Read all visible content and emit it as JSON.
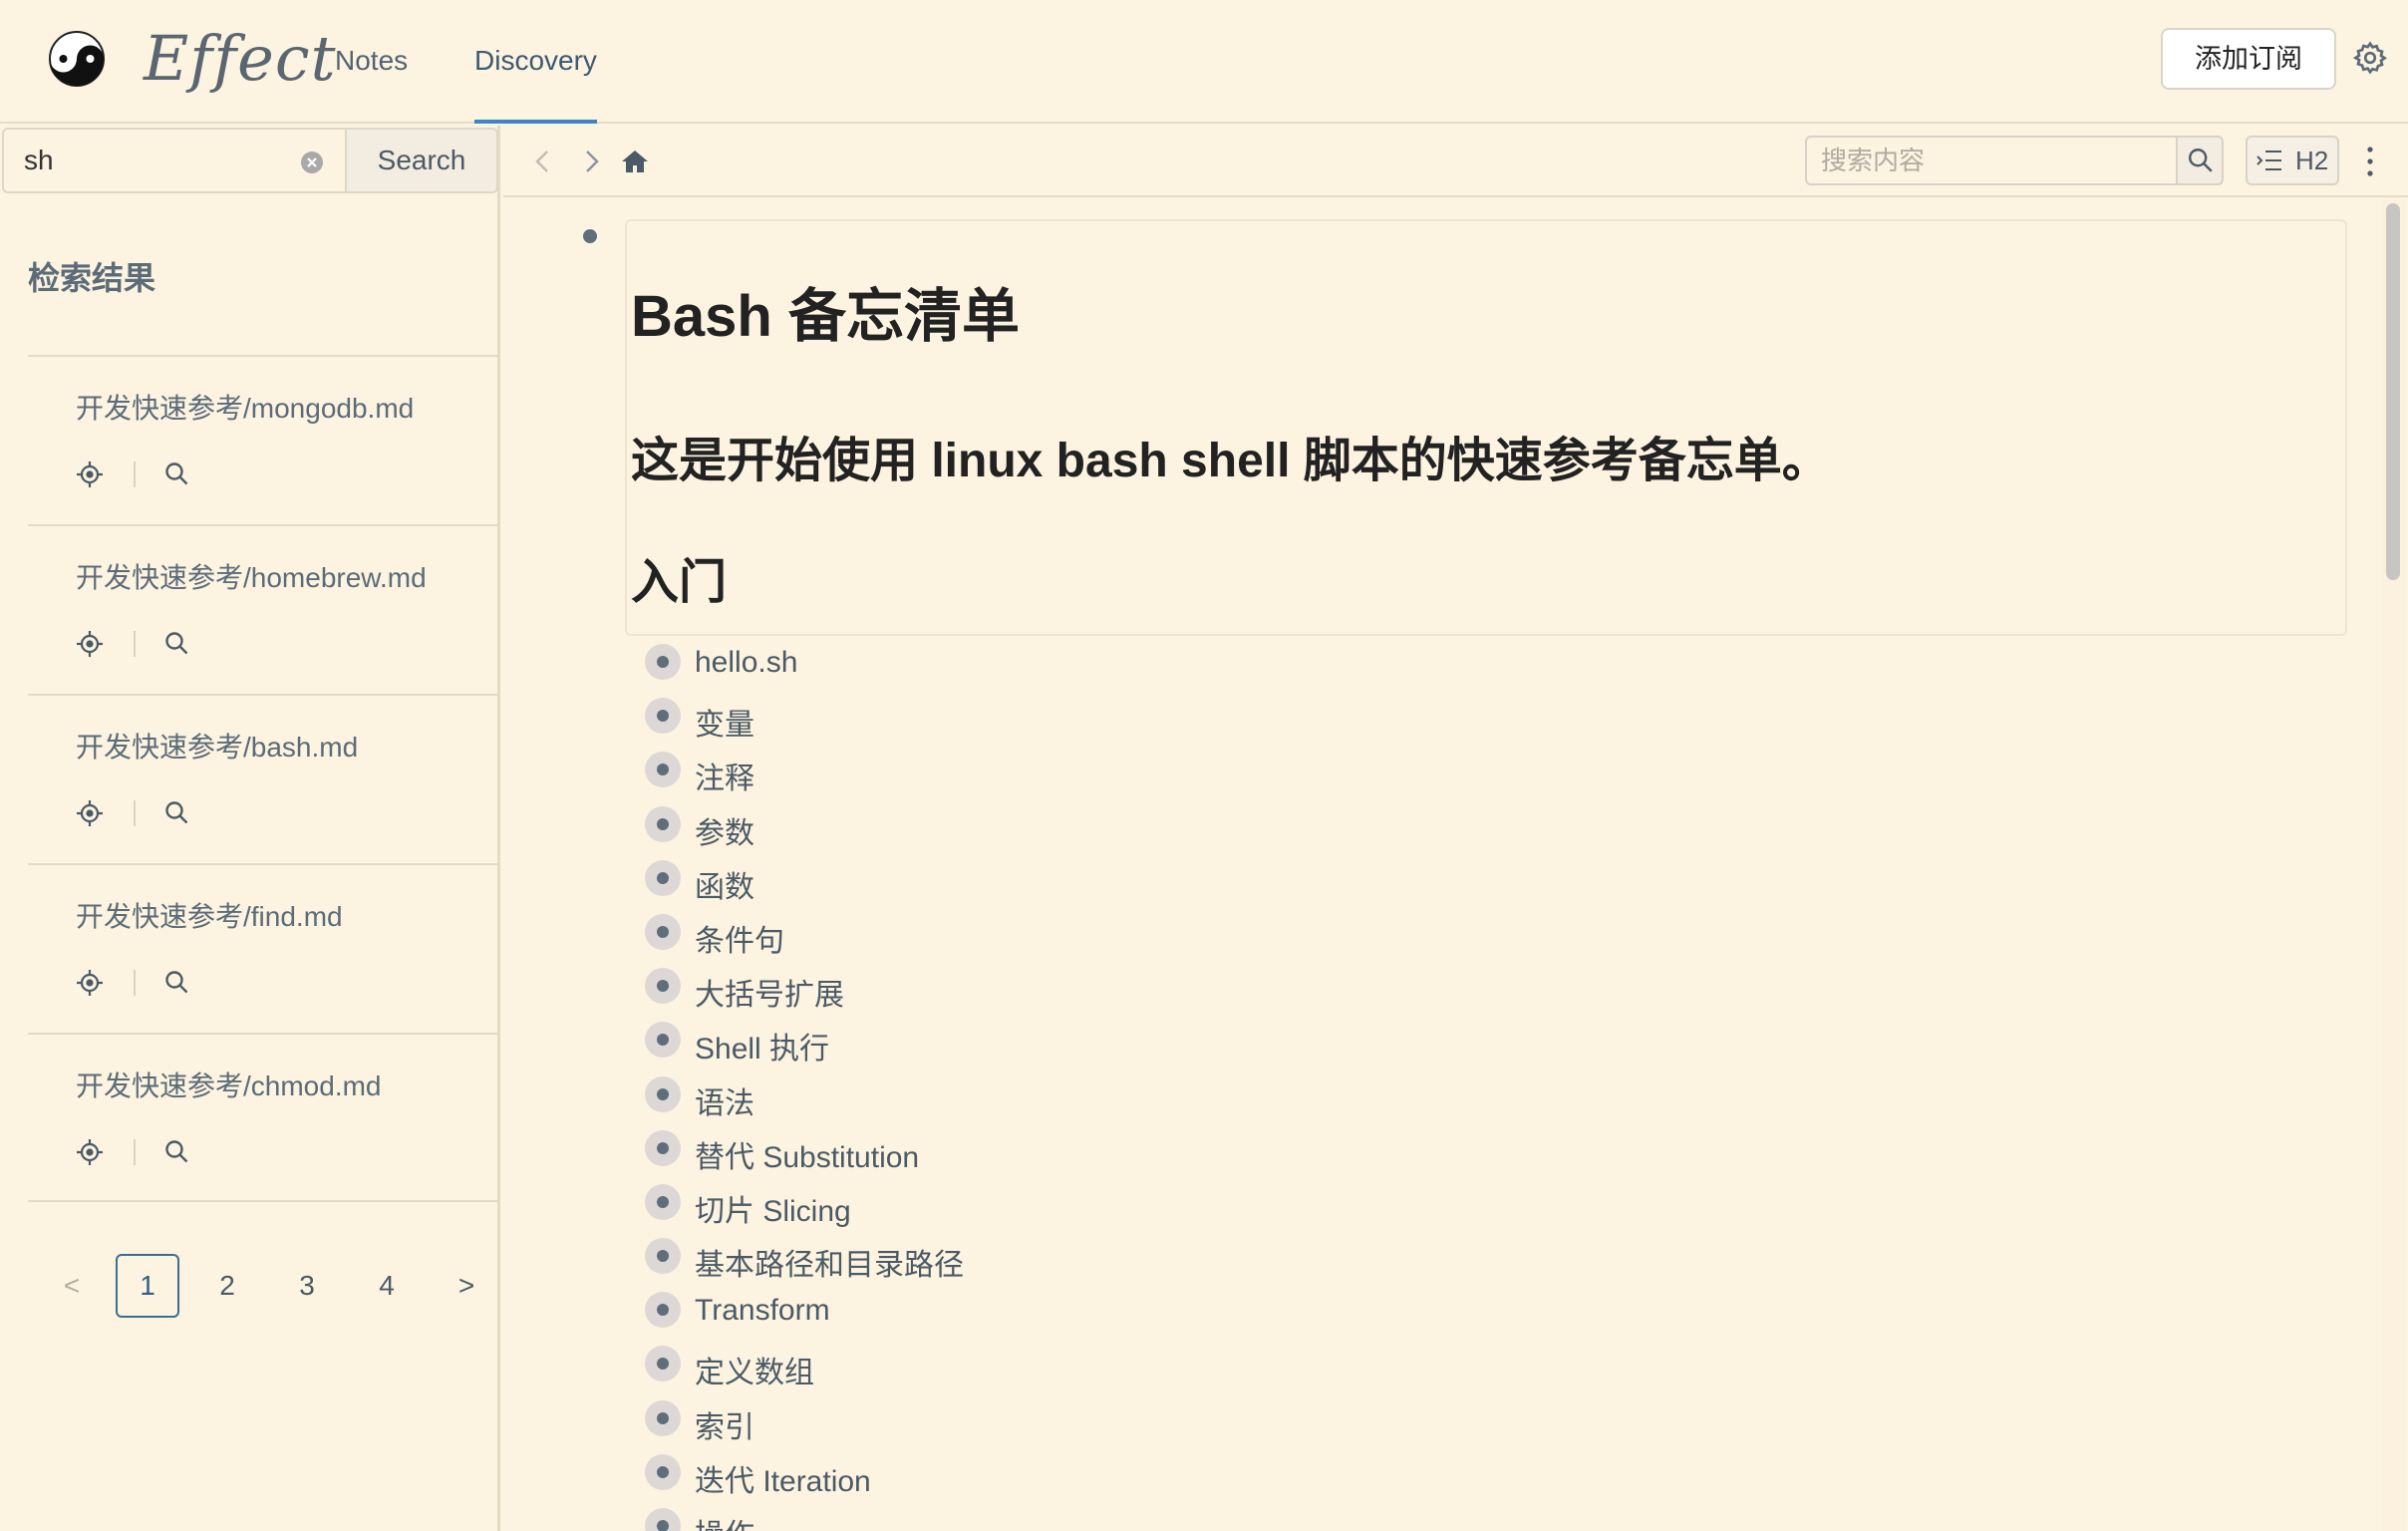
{
  "app": {
    "logo_text": "Effect",
    "nav": [
      {
        "label": "Notes"
      },
      {
        "label": "Discovery"
      }
    ],
    "add_subscription_label": "添加订阅",
    "accent_color": "#3a87c8"
  },
  "sidebar": {
    "search_value": "sh",
    "search_button_label": "Search",
    "results_title": "检索结果",
    "results": [
      {
        "path": "开发快速参考/mongodb.md"
      },
      {
        "path": "开发快速参考/homebrew.md"
      },
      {
        "path": "开发快速参考/bash.md"
      },
      {
        "path": "开发快速参考/find.md"
      },
      {
        "path": "开发快速参考/chmod.md"
      }
    ],
    "pagination": {
      "prev": "<",
      "pages": [
        "1",
        "2",
        "3",
        "4"
      ],
      "current": "1",
      "next": ">"
    }
  },
  "toolbar": {
    "search_placeholder": "搜索内容",
    "heading_level_label": "H2"
  },
  "document": {
    "title": "Bash 备忘清单",
    "subtitle": "这是开始使用 linux bash shell 脚本的快速参考备忘单。",
    "section": "入门",
    "toc": [
      "hello.sh",
      "变量",
      "注释",
      "参数",
      "函数",
      "条件句",
      "大括号扩展",
      "Shell 执行",
      "语法",
      "替代 Substitution",
      "切片 Slicing",
      "基本路径和目录路径",
      "Transform",
      "定义数组",
      "索引",
      "迭代 Iteration",
      "操作"
    ]
  }
}
